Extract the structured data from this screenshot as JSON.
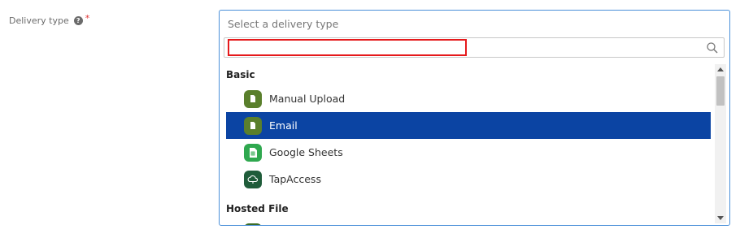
{
  "field": {
    "label": "Delivery type",
    "help_icon": "question-circle-icon",
    "required_marker": "*"
  },
  "dropdown": {
    "placeholder": "Select a delivery type",
    "search_value": "",
    "search_icon": "search-icon"
  },
  "groups": [
    {
      "label": "Basic",
      "options": [
        {
          "label": "Manual Upload",
          "icon": "document-icon",
          "color": "#5a7f2c",
          "selected": false
        },
        {
          "label": "Email",
          "icon": "document-icon",
          "color": "#5a7f2c",
          "selected": true
        },
        {
          "label": "Google Sheets",
          "icon": "sheet-icon",
          "color": "#2fa84f",
          "selected": false
        },
        {
          "label": "TapAccess",
          "icon": "cloud-icon",
          "color": "#1f5c3a",
          "selected": false
        }
      ]
    },
    {
      "label": "Hosted File",
      "options": []
    }
  ],
  "colors": {
    "selected_background": "#0b44a3",
    "focus_border": "#4a90d9",
    "highlight_outline": "#e5191b"
  }
}
